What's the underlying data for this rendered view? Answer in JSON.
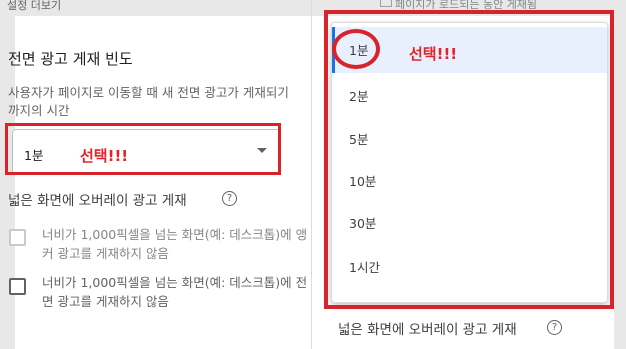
{
  "left": {
    "top_clip": "설정 더보기",
    "section_title": "전면 광고 게재 빈도",
    "description": "사용자가 페이지로 이동할 때 새 전면 광고가 게재되기까지의 시간",
    "select_value": "1분",
    "pick_annotation": "선택!!!",
    "overlay_title": "넓은 화면에 오버레이 광고 게재",
    "help_icon": "?",
    "options": [
      {
        "label": "너비가 1,000픽셀을 넘는 화면(예: 데스크톱)에 앵커 광고를 게재하지 않음",
        "checked": false,
        "disabled": true
      },
      {
        "label": "너비가 1,000픽셀을 넘는 화면(예: 데스크톱)에 전면 광고를 게재하지 않음",
        "checked": false,
        "disabled": false
      }
    ]
  },
  "right": {
    "top_clip": "페이지가 로드되는 동안 게재됨",
    "pick_annotation": "선택!!!",
    "dropdown_items": [
      "1분",
      "2분",
      "5분",
      "10분",
      "30분",
      "1시간"
    ],
    "selected_index": 0,
    "overlay_title": "넓은 화면에 오버레이 광고 게재",
    "help_icon": "?"
  },
  "colors": {
    "annotation_red": "#d9232b",
    "selected_bg": "#e8f0fe",
    "accent_blue": "#1a73e8"
  }
}
